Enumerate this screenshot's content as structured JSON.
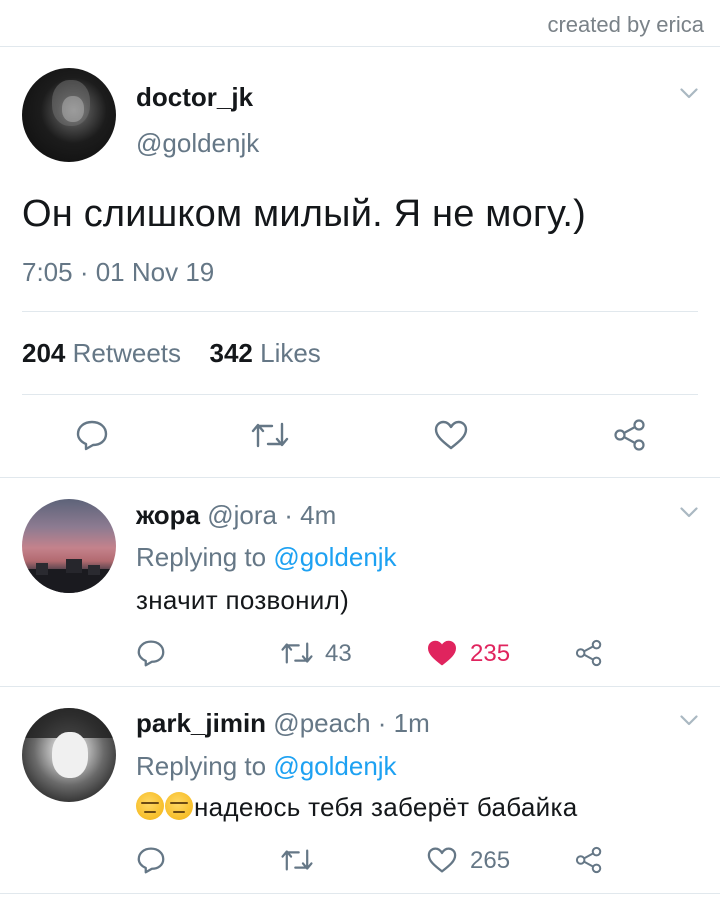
{
  "credit": "created by erica",
  "main_tweet": {
    "display_name": "doctor_jk",
    "handle": "@goldenjk",
    "text": "Он слишком милый. Я не могу.)",
    "timestamp": "7:05 · 01 Nov 19",
    "retweets_count": "204",
    "retweets_label": "Retweets",
    "likes_count": "342",
    "likes_label": "Likes"
  },
  "replies": [
    {
      "display_name": "жора",
      "handle": "@jora",
      "time": "· 4m",
      "replying_prefix": "Replying to",
      "replying_handle": "@goldenjk",
      "text": "значит позвонил)",
      "retweets": "43",
      "likes": "235",
      "liked": true,
      "accent_color": "#e0245e"
    },
    {
      "display_name": "park_jimin",
      "handle": "@peach",
      "time": "· 1m",
      "replying_prefix": "Replying to",
      "replying_handle": "@goldenjk",
      "emoji": "expressionless-face",
      "text": "надеюсь тебя заберёт бабайка",
      "retweets": "",
      "likes": "265",
      "liked": false
    }
  ],
  "colors": {
    "link": "#1da1f2",
    "secondary_text": "#657786",
    "divider": "#e1e8ed",
    "like_active": "#e0245e"
  },
  "icons": [
    "reply-icon",
    "retweet-icon",
    "like-icon",
    "share-icon",
    "chevron-down-icon"
  ]
}
